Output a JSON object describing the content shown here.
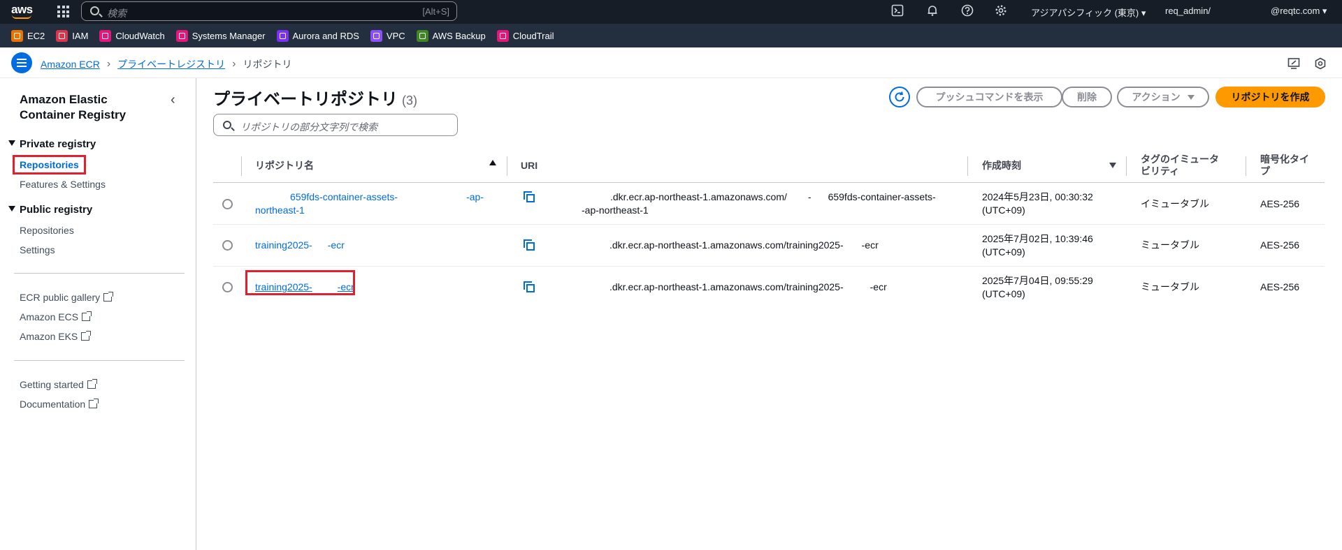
{
  "topnav": {
    "logo_text": "aws",
    "search_placeholder": "検索",
    "search_shortcut": "[Alt+S]",
    "region": "アジアパシフィック (東京) ▾",
    "user": "req_admin/",
    "account": "@reqtc.com ▾"
  },
  "services": [
    {
      "label": "EC2",
      "color": "#ed7100"
    },
    {
      "label": "IAM",
      "color": "#dd344c"
    },
    {
      "label": "CloudWatch",
      "color": "#e7157b"
    },
    {
      "label": "Systems Manager",
      "color": "#e7157b"
    },
    {
      "label": "Aurora and RDS",
      "color": "#7b2ff7"
    },
    {
      "label": "VPC",
      "color": "#8c4fff"
    },
    {
      "label": "AWS Backup",
      "color": "#3f8624"
    },
    {
      "label": "CloudTrail",
      "color": "#e7157b"
    }
  ],
  "breadcrumb": {
    "items": [
      "Amazon ECR",
      "プライベートレジストリ"
    ],
    "current": "リポジトリ"
  },
  "sidebar": {
    "title": "Amazon Elastic Container Registry",
    "private_registry": "Private registry",
    "private_items": [
      "Repositories",
      "Features & Settings"
    ],
    "public_registry": "Public registry",
    "public_items": [
      "Repositories",
      "Settings"
    ],
    "external_links": [
      "ECR public gallery",
      "Amazon ECS",
      "Amazon EKS"
    ],
    "help_links": [
      "Getting started",
      "Documentation"
    ]
  },
  "page": {
    "title": "プライベートリポジトリ",
    "count": "(3)",
    "buttons": {
      "push_commands": "プッシュコマンドを表示",
      "delete": "削除",
      "actions": "アクション",
      "create": "リポジトリを作成"
    },
    "filter_placeholder": "リポジトリの部分文字列で検索"
  },
  "table": {
    "headers": {
      "name": "リポジトリ名",
      "uri": "URI",
      "created": "作成時刻",
      "mutability": "タグのイミュータビリティ",
      "encryption": "暗号化タイプ"
    },
    "rows": [
      {
        "name_line1": "659fds-container-assets-",
        "name_line1b": "-ap-",
        "name_line2": "northeast-1",
        "uri_line1a": ".dkr.ecr.ap-northeast-1.amazonaws.com/",
        "uri_line1b": "-",
        "uri_line1c": "659fds-container-assets-",
        "uri_line2": "-ap-northeast-1",
        "created_line1": "2024年5月23日, 00:30:32",
        "created_line2": "(UTC+09)",
        "mutability": "イミュータブル",
        "encryption": "AES-256"
      },
      {
        "name_a": "training2025-",
        "name_b": "-ecr",
        "uri_a": ".dkr.ecr.ap-northeast-1.amazonaws.com/training2025-",
        "uri_b": "-ecr",
        "created_line1": "2025年7月02日, 10:39:46",
        "created_line2": "(UTC+09)",
        "mutability": "ミュータブル",
        "encryption": "AES-256"
      },
      {
        "name_a": "training2025-",
        "name_b": "-ecr",
        "uri_a": ".dkr.ecr.ap-northeast-1.amazonaws.com/training2025-",
        "uri_b": "-ecr",
        "created_line1": "2025年7月04日, 09:55:29",
        "created_line2": "(UTC+09)",
        "mutability": "ミュータブル",
        "encryption": "AES-256"
      }
    ]
  }
}
